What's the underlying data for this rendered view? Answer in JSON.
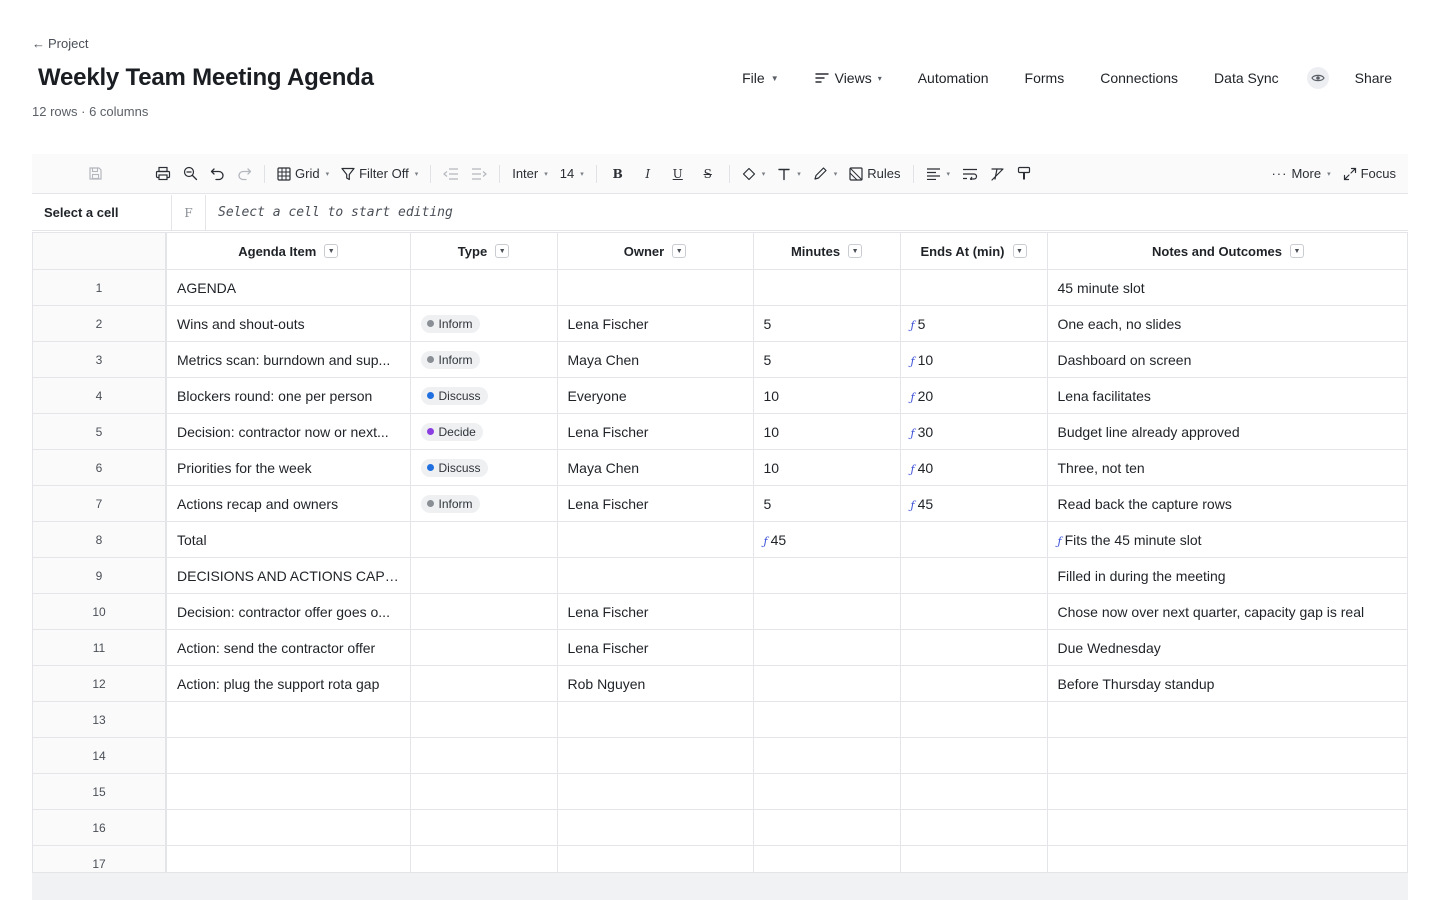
{
  "header": {
    "back_label": "Project",
    "title": "Weekly Team Meeting Agenda",
    "meta": "12 rows · 6 columns"
  },
  "nav": {
    "file": "File",
    "views": "Views",
    "automation": "Automation",
    "forms": "Forms",
    "connections": "Connections",
    "data_sync": "Data Sync",
    "share": "Share"
  },
  "toolbar": {
    "grid": "Grid",
    "filter": "Filter Off",
    "font": "Inter",
    "size": "14",
    "rules": "Rules",
    "more": "More",
    "focus": "Focus"
  },
  "formula": {
    "cell_ref": "Select a cell",
    "fx": "F",
    "placeholder": "Select a cell to start editing"
  },
  "colors": {
    "inform": "#8a8f96",
    "discuss": "#1f6fe0",
    "decide": "#8a3ee0",
    "formula": "#3b4fd8"
  },
  "columns": [
    "Agenda Item",
    "Type",
    "Owner",
    "Minutes",
    "Ends At (min)",
    "Notes and Outcomes"
  ],
  "rows": [
    {
      "n": "1",
      "item": "AGENDA",
      "type": "",
      "owner": "",
      "minutes": "",
      "minutes_fx": false,
      "ends": "",
      "notes": "45 minute slot",
      "notes_fx": false
    },
    {
      "n": "2",
      "item": "Wins and shout-outs",
      "type": "Inform",
      "owner": "Lena Fischer",
      "minutes": "5",
      "minutes_fx": false,
      "ends": "5",
      "notes": "One each, no slides",
      "notes_fx": false
    },
    {
      "n": "3",
      "item": "Metrics scan: burndown and sup...",
      "type": "Inform",
      "owner": "Maya Chen",
      "minutes": "5",
      "minutes_fx": false,
      "ends": "10",
      "notes": "Dashboard on screen",
      "notes_fx": false
    },
    {
      "n": "4",
      "item": "Blockers round: one per person",
      "type": "Discuss",
      "owner": "Everyone",
      "minutes": "10",
      "minutes_fx": false,
      "ends": "20",
      "notes": "Lena facilitates",
      "notes_fx": false
    },
    {
      "n": "5",
      "item": "Decision: contractor now or next...",
      "type": "Decide",
      "owner": "Lena Fischer",
      "minutes": "10",
      "minutes_fx": false,
      "ends": "30",
      "notes": "Budget line already approved",
      "notes_fx": false
    },
    {
      "n": "6",
      "item": "Priorities for the week",
      "type": "Discuss",
      "owner": "Maya Chen",
      "minutes": "10",
      "minutes_fx": false,
      "ends": "40",
      "notes": "Three, not ten",
      "notes_fx": false
    },
    {
      "n": "7",
      "item": "Actions recap and owners",
      "type": "Inform",
      "owner": "Lena Fischer",
      "minutes": "5",
      "minutes_fx": false,
      "ends": "45",
      "notes": "Read back the capture rows",
      "notes_fx": false
    },
    {
      "n": "8",
      "item": "Total",
      "type": "",
      "owner": "",
      "minutes": "45",
      "minutes_fx": true,
      "ends": "",
      "notes": "Fits the 45 minute slot",
      "notes_fx": true
    },
    {
      "n": "9",
      "item": "DECISIONS AND ACTIONS CAPT...",
      "type": "",
      "owner": "",
      "minutes": "",
      "minutes_fx": false,
      "ends": "",
      "notes": "Filled in during the meeting",
      "notes_fx": false
    },
    {
      "n": "10",
      "item": "Decision: contractor offer goes o...",
      "type": "",
      "owner": "Lena Fischer",
      "minutes": "",
      "minutes_fx": false,
      "ends": "",
      "notes": "Chose now over next quarter, capacity gap is real",
      "notes_fx": false
    },
    {
      "n": "11",
      "item": "Action: send the contractor offer",
      "type": "",
      "owner": "Lena Fischer",
      "minutes": "",
      "minutes_fx": false,
      "ends": "",
      "notes": "Due Wednesday",
      "notes_fx": false
    },
    {
      "n": "12",
      "item": "Action: plug the support rota gap",
      "type": "",
      "owner": "Rob Nguyen",
      "minutes": "",
      "minutes_fx": false,
      "ends": "",
      "notes": "Before Thursday standup",
      "notes_fx": false
    },
    {
      "n": "13",
      "item": "",
      "type": "",
      "owner": "",
      "minutes": "",
      "minutes_fx": false,
      "ends": "",
      "notes": "",
      "notes_fx": false
    },
    {
      "n": "14",
      "item": "",
      "type": "",
      "owner": "",
      "minutes": "",
      "minutes_fx": false,
      "ends": "",
      "notes": "",
      "notes_fx": false
    },
    {
      "n": "15",
      "item": "",
      "type": "",
      "owner": "",
      "minutes": "",
      "minutes_fx": false,
      "ends": "",
      "notes": "",
      "notes_fx": false
    },
    {
      "n": "16",
      "item": "",
      "type": "",
      "owner": "",
      "minutes": "",
      "minutes_fx": false,
      "ends": "",
      "notes": "",
      "notes_fx": false
    },
    {
      "n": "17",
      "item": "",
      "type": "",
      "owner": "",
      "minutes": "",
      "minutes_fx": false,
      "ends": "",
      "notes": "",
      "notes_fx": false
    }
  ]
}
